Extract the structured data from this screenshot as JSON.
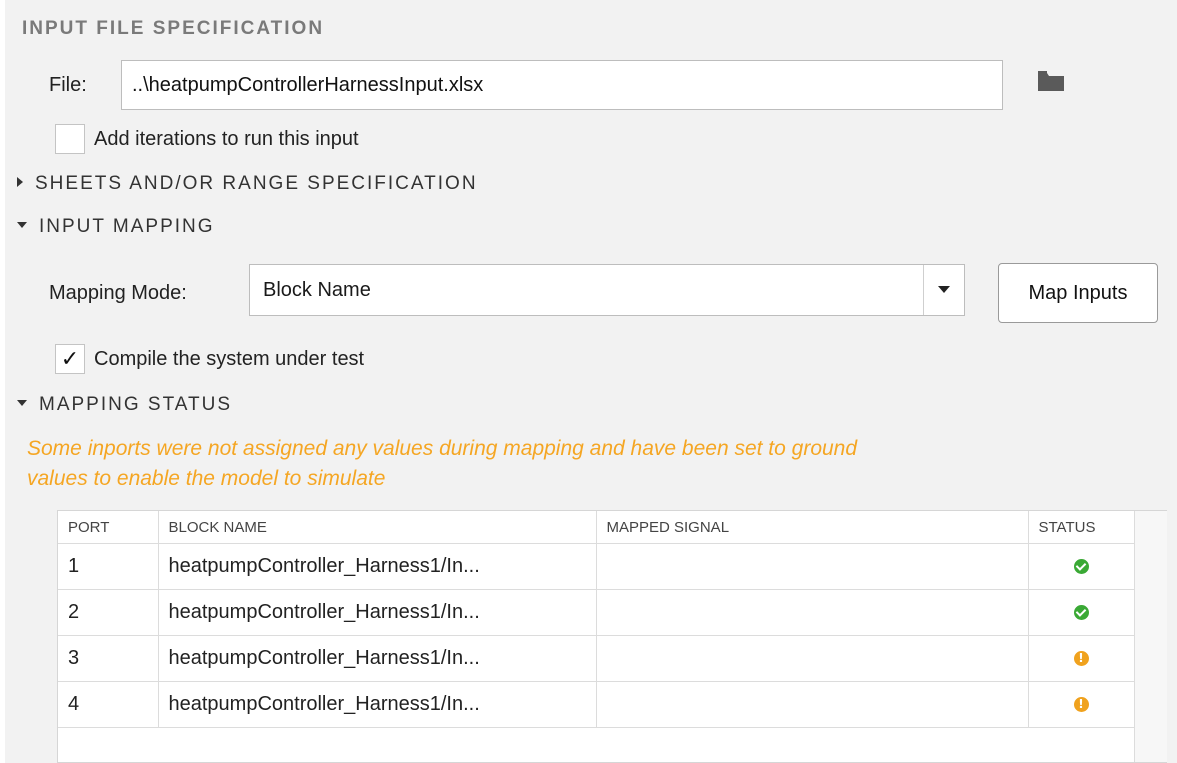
{
  "input_file_spec": {
    "title": "INPUT FILE SPECIFICATION",
    "file_label": "File:",
    "file_value": "..\\heatpumpControllerHarnessInput.xlsx",
    "add_iterations_label": "Add iterations to run this input",
    "add_iterations_checked": false
  },
  "sheets_section": {
    "title": "SHEETS AND/OR RANGE SPECIFICATION",
    "expanded": false
  },
  "input_mapping": {
    "title": "INPUT MAPPING",
    "expanded": true,
    "mode_label": "Mapping Mode:",
    "mode_value": "Block Name",
    "map_button": "Map Inputs",
    "compile_label": "Compile the system under test",
    "compile_checked": true,
    "compile_mark": "✓"
  },
  "mapping_status": {
    "title": "MAPPING STATUS",
    "expanded": true,
    "warning_line1": "Some inports were not assigned any values during mapping and have been set to ground",
    "warning_line2": "values to enable the model to simulate",
    "warning_color": "#f5a623",
    "columns": [
      "PORT",
      "BLOCK NAME",
      "MAPPED SIGNAL",
      "STATUS"
    ],
    "rows": [
      {
        "port": "1",
        "block": "heatpumpController_Harness1/In...",
        "signal": "",
        "status": "ok"
      },
      {
        "port": "2",
        "block": "heatpumpController_Harness1/In...",
        "signal": "",
        "status": "ok"
      },
      {
        "port": "3",
        "block": "heatpumpController_Harness1/In...",
        "signal": "",
        "status": "warning"
      },
      {
        "port": "4",
        "block": "heatpumpController_Harness1/In...",
        "signal": "",
        "status": "warning"
      }
    ],
    "status_colors": {
      "ok": "#3aa935",
      "warning": "#f0a21e"
    }
  }
}
